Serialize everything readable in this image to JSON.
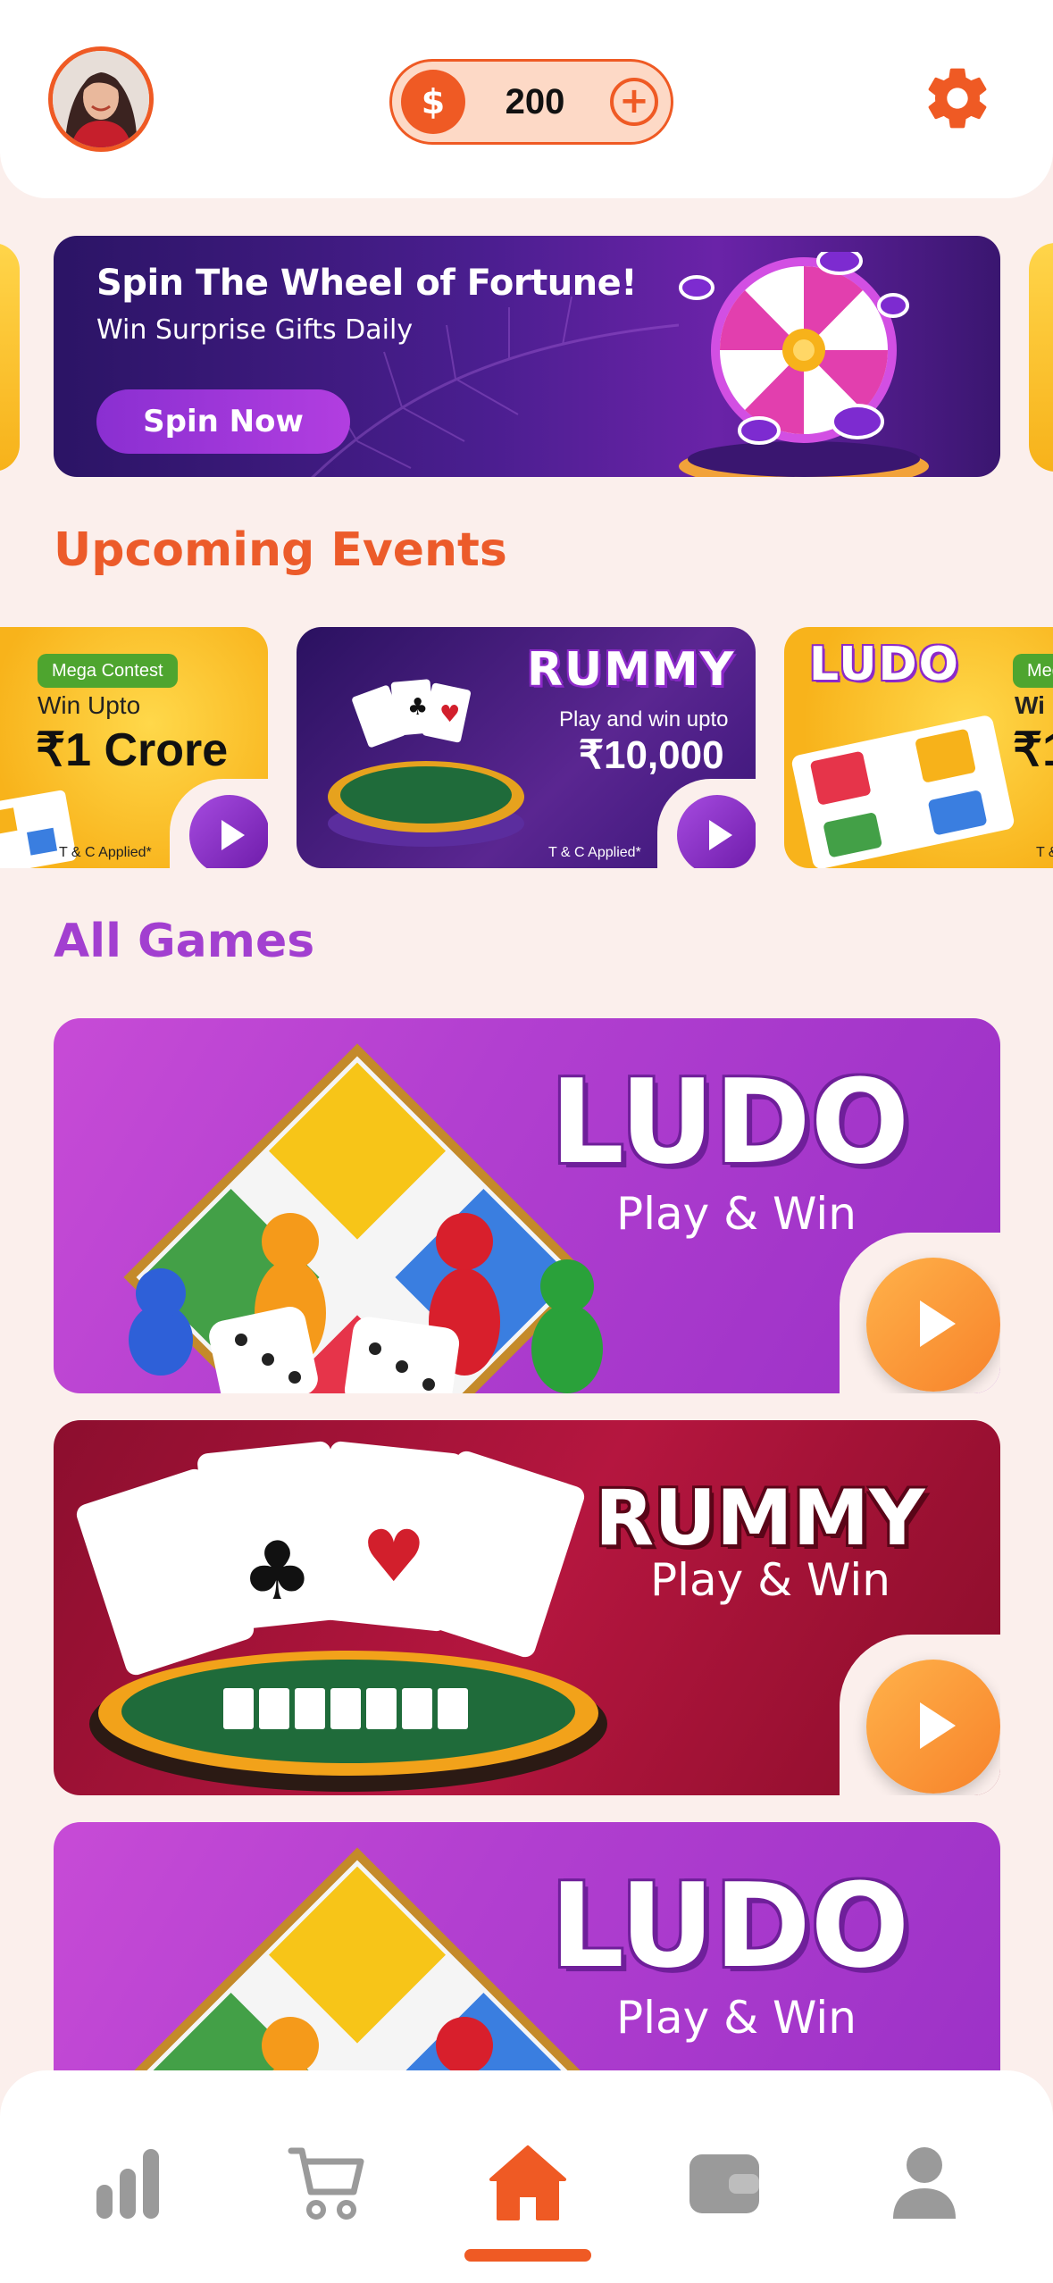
{
  "header": {
    "coin_symbol": "$",
    "coin_balance": "200",
    "add_symbol": "+"
  },
  "promo": {
    "title": "Spin The Wheel of Fortune!",
    "subtitle": "Win Surprise Gifts Daily",
    "button": "Spin Now"
  },
  "sections": {
    "upcoming": "Upcoming Events",
    "all_games": "All Games"
  },
  "events": [
    {
      "badge": "Mega Contest",
      "line1": "Win Upto",
      "amount": "₹1 Crore",
      "terms": "T & C Applied*"
    },
    {
      "game": "RUMMY",
      "line1": "Play and win upto",
      "amount": "₹10,000",
      "terms": "T & C Applied*"
    },
    {
      "game": "LUDO",
      "badge": "Meg",
      "line1": "Wi",
      "amount": "₹1",
      "terms": "T &"
    }
  ],
  "games": [
    {
      "title": "LUDO",
      "subtitle": "Play & Win"
    },
    {
      "title": "RUMMY",
      "subtitle": "Play & Win"
    },
    {
      "title": "LUDO",
      "subtitle": "Play & Win"
    }
  ],
  "colors": {
    "accent": "#ef5a24",
    "purple_title": "#a23fd0",
    "background": "#fbefec",
    "nav_inactive": "#9a9a9a"
  },
  "nav": {
    "items": [
      "leaderboard-icon",
      "cart-icon",
      "home-icon",
      "wallet-icon",
      "profile-icon"
    ],
    "active": "home-icon"
  }
}
